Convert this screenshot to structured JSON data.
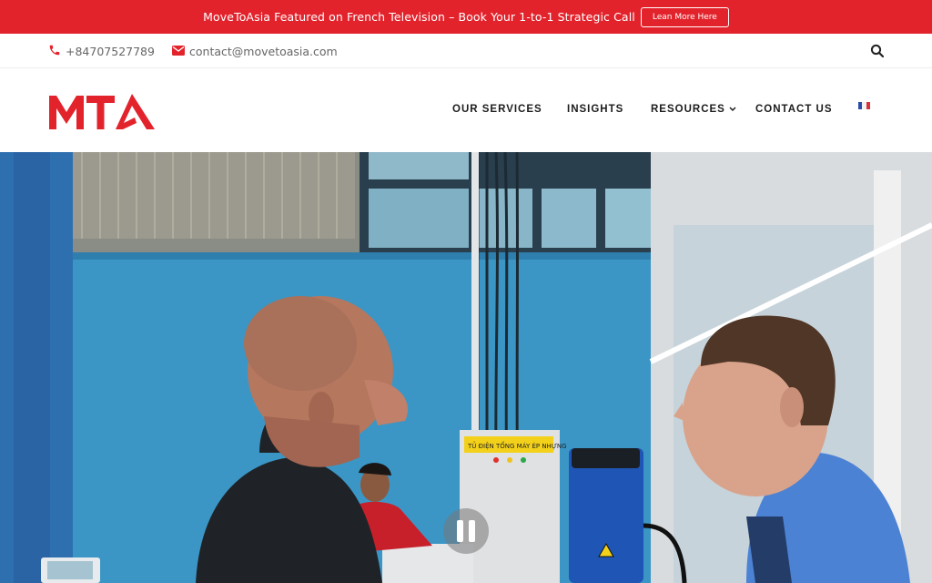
{
  "announcement": {
    "text": "MoveToAsia Featured on French Television – Book Your 1-to-1 Strategic Call",
    "button_label": "Lean More Here"
  },
  "contact": {
    "phone": "+84707527789",
    "email": "contact@movetoasia.com"
  },
  "brand": {
    "logo_text": "MTA",
    "accent_color": "#e3232c"
  },
  "nav": {
    "items": [
      {
        "label": "OUR SERVICES"
      },
      {
        "label": "INSIGHTS"
      },
      {
        "label": "RESOURCES",
        "has_dropdown": true
      },
      {
        "label": "CONTACT US"
      }
    ],
    "language_flag": "france-flag-icon"
  },
  "hero": {
    "media": "video",
    "state": "playing",
    "control_icon": "pause-icon",
    "sign_text": "TỦ ĐIỆN TỔNG MÁY ÉP NHỰNG"
  },
  "icons": {
    "phone": "phone-icon",
    "email": "envelope-icon",
    "search": "search-icon",
    "dropdown": "chevron-down-icon"
  }
}
